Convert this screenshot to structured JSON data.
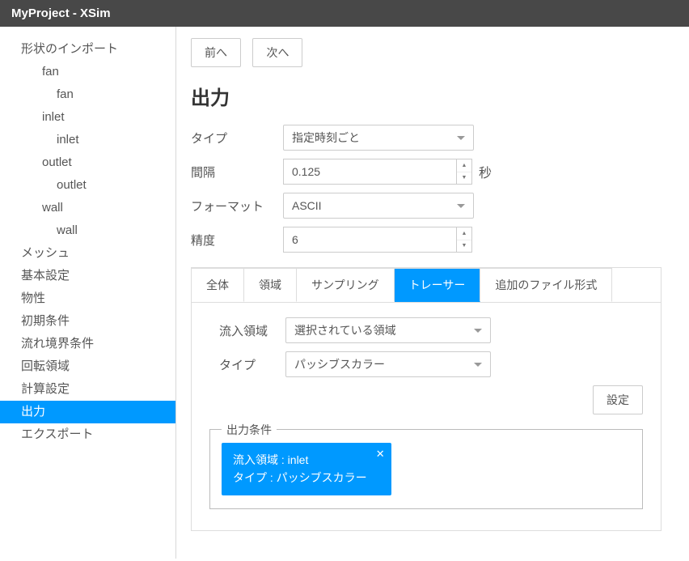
{
  "title": "MyProject - XSim",
  "sidebar": [
    {
      "label": "形状のインポート",
      "lvl": 1
    },
    {
      "label": "fan",
      "lvl": 2
    },
    {
      "label": "fan",
      "lvl": 3
    },
    {
      "label": "inlet",
      "lvl": 2
    },
    {
      "label": "inlet",
      "lvl": 3
    },
    {
      "label": "outlet",
      "lvl": 2
    },
    {
      "label": "outlet",
      "lvl": 3
    },
    {
      "label": "wall",
      "lvl": 2
    },
    {
      "label": "wall",
      "lvl": 3
    },
    {
      "label": "メッシュ",
      "lvl": 1
    },
    {
      "label": "基本設定",
      "lvl": 1
    },
    {
      "label": "物性",
      "lvl": 1
    },
    {
      "label": "初期条件",
      "lvl": 1
    },
    {
      "label": "流れ境界条件",
      "lvl": 1
    },
    {
      "label": "回転領域",
      "lvl": 1
    },
    {
      "label": "計算設定",
      "lvl": 1
    },
    {
      "label": "出力",
      "lvl": 1,
      "selected": true
    },
    {
      "label": "エクスポート",
      "lvl": 1
    }
  ],
  "nav": {
    "prev": "前へ",
    "next": "次へ"
  },
  "heading": "出力",
  "fields": {
    "type_label": "タイプ",
    "type_value": "指定時刻ごと",
    "interval_label": "間隔",
    "interval_value": "0.125",
    "interval_unit": "秒",
    "format_label": "フォーマット",
    "format_value": "ASCII",
    "precision_label": "精度",
    "precision_value": "6"
  },
  "tabs": [
    {
      "label": "全体"
    },
    {
      "label": "領域"
    },
    {
      "label": "サンプリング"
    },
    {
      "label": "トレーサー",
      "active": true
    },
    {
      "label": "追加のファイル形式"
    }
  ],
  "tracer": {
    "inflow_label": "流入領域",
    "inflow_value": "選択されている領域",
    "type_label": "タイプ",
    "type_value": "パッシブスカラー",
    "set_button": "設定",
    "fieldset_title": "出力条件",
    "chip_line1": "流入領域 : inlet",
    "chip_line2": "タイプ : パッシブスカラー"
  }
}
